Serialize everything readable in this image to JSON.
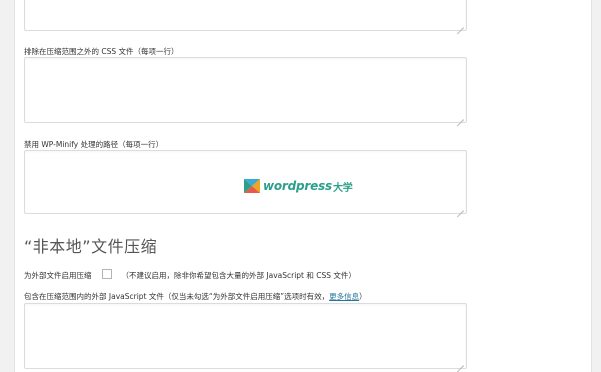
{
  "fields": {
    "css_exclude_label": "排除在压缩范围之外的 CSS 文件（每项一行）",
    "disable_paths_label": "禁用 WP-Minify 处理的路径（每项一行）",
    "external_js_label": "包含在压缩范围内的外部 JavaScript 文件（仅当未勾选“为外部文件启用压缩”选项时有效，",
    "external_js_link": "更多信息",
    "external_js_label_end": "）"
  },
  "section": {
    "title": "“非本地”文件压缩"
  },
  "external_option": {
    "label": "为外部文件启用压缩",
    "hint": "（不建议启用，除非你希望包含大量的外部 JavaScript 和 CSS 文件）",
    "checked": false
  },
  "watermark": {
    "text": "wordpress",
    "suffix": "大学",
    "icon": "wordpress-daxue-logo-icon"
  }
}
